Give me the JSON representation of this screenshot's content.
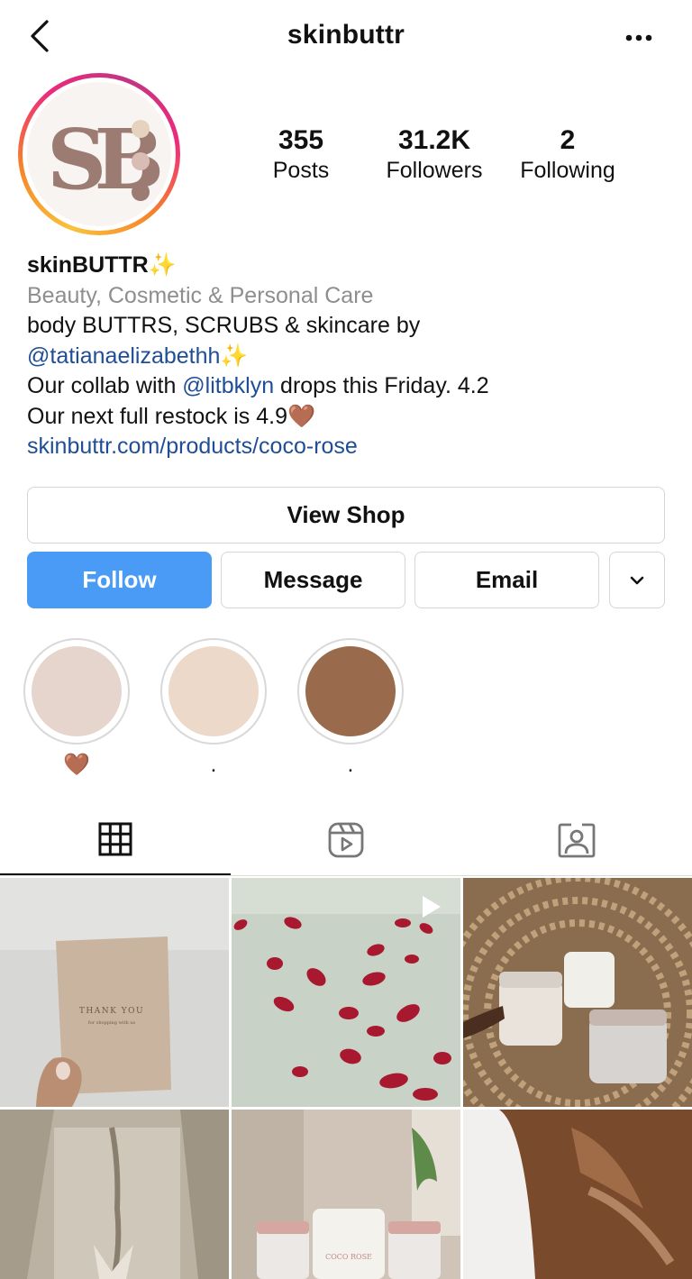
{
  "header": {
    "username": "skinbuttr"
  },
  "profile": {
    "logo_text": "SB",
    "stats": [
      {
        "value": "355",
        "label": "Posts"
      },
      {
        "value": "31.2K",
        "label": "Followers"
      },
      {
        "value": "2",
        "label": "Following"
      }
    ]
  },
  "bio": {
    "name": "skinBUTTR",
    "name_emoji": "✨",
    "category": "Beauty, Cosmetic & Personal Care",
    "line1": "body BUTTRS, SCRUBS & skincare by",
    "mention1": "@tatianaelizabethh",
    "mention1_emoji": "✨",
    "line3_prefix": "Our collab with ",
    "mention2": "@litbklyn",
    "line3_suffix": " drops this Friday. 4.2",
    "line4": "Our next full restock is 4.9",
    "line4_emoji": "🤎",
    "link": "skinbuttr.com/products/coco-rose"
  },
  "buttons": {
    "view_shop": "View Shop",
    "follow": "Follow",
    "message": "Message",
    "email": "Email"
  },
  "highlights": [
    {
      "label": "🤎",
      "color": "#e6d5cc"
    },
    {
      "label": ".",
      "color": "#ecd9c9"
    },
    {
      "label": ".",
      "color": "#9a6a4c"
    }
  ],
  "grid": {
    "post1_card_title": "THANK YOU",
    "post1_card_subtitle": "for shopping with us",
    "post5_label": "COCO ROSE"
  },
  "colors": {
    "accent_blue": "#4a9bf5",
    "link_blue": "#1f4e96",
    "muted_gray": "#8e8e8e",
    "logo_brown": "#9c7b72"
  }
}
